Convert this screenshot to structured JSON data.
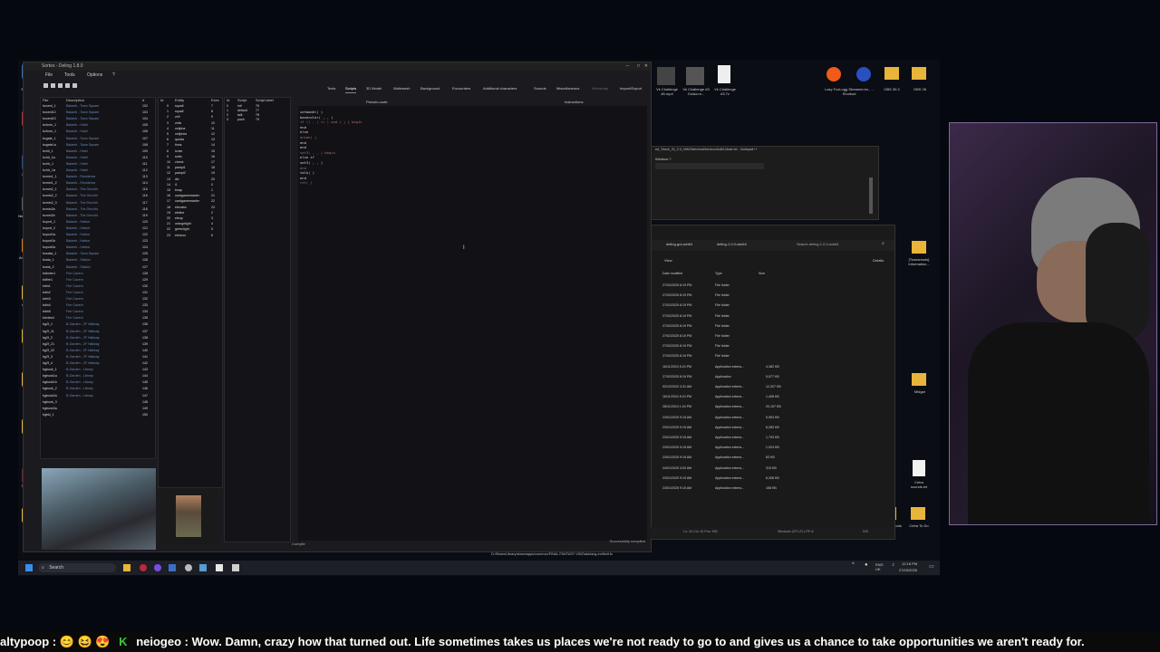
{
  "editor": {
    "title": "Sortes - Deling 1.8.0",
    "menu": [
      "File",
      "Tools",
      "Options",
      "?"
    ],
    "tabs": [
      "Texts",
      "Scripts",
      "3D Model",
      "Walkmesh",
      "Background",
      "Encounters",
      "Additional characters",
      "Sounds",
      "Miscellaneous",
      "Worldmap",
      "Import/Export"
    ],
    "field_headers": [
      "File",
      "Description",
      "#"
    ],
    "entity_headers": [
      "Id",
      "Entity",
      "Exec"
    ],
    "script_headers": [
      "Id",
      "Script",
      "Script label"
    ],
    "code_tabs": [
      "Pseudo-code",
      "Instructions"
    ],
    "fields": [
      {
        "file": "bccent_1",
        "desc": "Balamb - Town Square",
        "n": "102"
      },
      {
        "file": "bccent12",
        "desc": "Balamb - Town Square",
        "n": "103"
      },
      {
        "file": "bccent13",
        "desc": "Balamb - Town Square",
        "n": "104"
      },
      {
        "file": "bcform_1",
        "desc": "Balamb - Hotel",
        "n": "105"
      },
      {
        "file": "bcform_1",
        "desc": "Balamb - Hotel",
        "n": "106"
      },
      {
        "file": "bcgate_1",
        "desc": "Balamb - Town Square",
        "n": "107"
      },
      {
        "file": "bcgate1a",
        "desc": "Balamb - Town Square",
        "n": "108"
      },
      {
        "file": "bchtl_1",
        "desc": "Balamb - Hotel",
        "n": "109"
      },
      {
        "file": "bchtl_1a",
        "desc": "Balamb - Hotel",
        "n": "110"
      },
      {
        "file": "bchtr_1",
        "desc": "Balamb - Hotel",
        "n": "111"
      },
      {
        "file": "bchtr_1a",
        "desc": "Balamb - Hotel",
        "n": "112"
      },
      {
        "file": "bcmin1_1",
        "desc": "Balamb - Residence",
        "n": "113"
      },
      {
        "file": "bcmin1_2",
        "desc": "Balamb - Residence",
        "n": "114"
      },
      {
        "file": "bcmin2_1",
        "desc": "Balamb - The Dincht's",
        "n": "115"
      },
      {
        "file": "bcmin2_2",
        "desc": "Balamb - The Dincht's",
        "n": "116"
      },
      {
        "file": "bcmin2_3",
        "desc": "Balamb - The Dincht's",
        "n": "117"
      },
      {
        "file": "bcmin2a",
        "desc": "Balamb - The Dincht's",
        "n": "118"
      },
      {
        "file": "bcmin2b",
        "desc": "Balamb - The Dincht's",
        "n": "119"
      },
      {
        "file": "bcport_1",
        "desc": "Balamb - Harbor",
        "n": "120"
      },
      {
        "file": "bcport_2",
        "desc": "Balamb - Harbor",
        "n": "121"
      },
      {
        "file": "bcport1a",
        "desc": "Balamb - Harbor",
        "n": "122"
      },
      {
        "file": "bcport1b",
        "desc": "Balamb - Harbor",
        "n": "123"
      },
      {
        "file": "bcport2a",
        "desc": "Balamb - Harbor",
        "n": "124"
      },
      {
        "file": "bcsaka_1",
        "desc": "Balamb - Town Square",
        "n": "125"
      },
      {
        "file": "bcsta_1",
        "desc": "Balamb - Station",
        "n": "126"
      },
      {
        "file": "bcsta_2",
        "desc": "Balamb - Station",
        "n": "127"
      },
      {
        "file": "bdenter1",
        "desc": "Fire Cavern",
        "n": "128"
      },
      {
        "file": "bdfire1",
        "desc": "Fire Cavern",
        "n": "129"
      },
      {
        "file": "bdin1",
        "desc": "Fire Cavern",
        "n": "130"
      },
      {
        "file": "bdin2",
        "desc": "Fire Cavern",
        "n": "131"
      },
      {
        "file": "bdin3",
        "desc": "Fire Cavern",
        "n": "132"
      },
      {
        "file": "bdin4",
        "desc": "Fire Cavern",
        "n": "133"
      },
      {
        "file": "bdin5",
        "desc": "Fire Cavern",
        "n": "134"
      },
      {
        "file": "bdview1",
        "desc": "Fire Cavern",
        "n": "135"
      },
      {
        "file": "bg2f_1",
        "desc": "B-Garden - 2F Hallway",
        "n": "136"
      },
      {
        "file": "bg2f_11",
        "desc": "B-Garden - 2F Hallway",
        "n": "137"
      },
      {
        "file": "bg2f_2",
        "desc": "B-Garden - 2F Hallway",
        "n": "138"
      },
      {
        "file": "bg2f_21",
        "desc": "B-Garden - 2F Hallway",
        "n": "139"
      },
      {
        "file": "bg2f_22",
        "desc": "B-Garden - 2F Hallway",
        "n": "140"
      },
      {
        "file": "bg2f_3",
        "desc": "B-Garden - 2F Hallway",
        "n": "141"
      },
      {
        "file": "bg2f_4",
        "desc": "B-Garden - 2F Hallway",
        "n": "142"
      },
      {
        "file": "bgbook_1",
        "desc": "B-Garden - Library",
        "n": "143"
      },
      {
        "file": "bgbook1a",
        "desc": "B-Garden - Library",
        "n": "144"
      },
      {
        "file": "bgbook1b",
        "desc": "B-Garden - Library",
        "n": "145"
      },
      {
        "file": "bgbook_2",
        "desc": "B-Garden - Library",
        "n": "146"
      },
      {
        "file": "bgbook2a",
        "desc": "B-Garden - Library",
        "n": "147"
      },
      {
        "file": "bgbook_3",
        "desc": "",
        "n": "148"
      },
      {
        "file": "bgbook3a",
        "desc": "",
        "n": "149"
      },
      {
        "file": "bgbkl_1",
        "desc": "",
        "n": "150"
      }
    ],
    "entities": [
      {
        "id": "0",
        "name": "squall",
        "n": "7"
      },
      {
        "id": "1",
        "name": "squall",
        "n": "8"
      },
      {
        "id": "2",
        "name": "zell",
        "n": "9"
      },
      {
        "id": "3",
        "name": "zells",
        "n": "10"
      },
      {
        "id": "4",
        "name": "cellpha",
        "n": "11"
      },
      {
        "id": "5",
        "name": "cellphes",
        "n": "12"
      },
      {
        "id": "6",
        "name": "quicks",
        "n": "13"
      },
      {
        "id": "7",
        "name": "tinos",
        "n": "14"
      },
      {
        "id": "8",
        "name": "ivoke",
        "n": "15"
      },
      {
        "id": "9",
        "name": "sotto",
        "n": "16"
      },
      {
        "id": "10",
        "name": "check",
        "n": "17"
      },
      {
        "id": "11",
        "name": "pampi1",
        "n": "18"
      },
      {
        "id": "12",
        "name": "pampi2",
        "n": "19"
      },
      {
        "id": "13",
        "name": "dic",
        "n": "20"
      },
      {
        "id": "14",
        "name": "l1",
        "n": "0"
      },
      {
        "id": "15",
        "name": "bnap",
        "n": "1"
      },
      {
        "id": "16",
        "name": "cardgamemaster",
        "n": "21"
      },
      {
        "id": "17",
        "name": "cardgamemaster",
        "n": "22"
      },
      {
        "id": "18",
        "name": "elevator",
        "n": "23"
      },
      {
        "id": "19",
        "name": "eleline",
        "n": "2"
      },
      {
        "id": "20",
        "name": "eleup",
        "n": "3"
      },
      {
        "id": "21",
        "name": "orangelight",
        "n": "4"
      },
      {
        "id": "22",
        "name": "greenlight",
        "n": "5"
      },
      {
        "id": "23",
        "name": "eledoor",
        "n": "6"
      }
    ],
    "scripts": [
      {
        "id": "0",
        "name": "init",
        "label": "76"
      },
      {
        "id": "1",
        "name": "default",
        "label": "77"
      },
      {
        "id": "2",
        "name": "talk",
        "label": "78"
      },
      {
        "id": "3",
        "name": "push",
        "label": "79"
      }
    ],
    "code_lines": [
      "setmodel( )",
      "basecolor( , , )",
      "if (( , ) == ) and ( ) { begin",
      "  end",
      "  else",
      "  anime( )",
      "  end",
      "  end",
      "  set3( , , ) begin",
      "else if",
      "  set3( , , )",
      "end",
      "  talk( )",
      "end",
      "ret( )"
    ],
    "compile_label": "Compile",
    "status_text": "Successfully compiled",
    "path_text": "D:/SteamLibrary/steamapps/common/FINAL FANTASY VIII/Data/lang-en/field.fs"
  },
  "notepad": {
    "title": "ed_Stock_SI_2.0_NWS\\bevinod\\bevinod\\rdl0-Mast.txt - Notepad++",
    "menu": "Window  ?"
  },
  "explorer": {
    "breadcrumb": [
      "deling-gui-win64",
      "deling-1.0.0-win64"
    ],
    "search_placeholder": "Search deling-1.0.0-win64",
    "view_label": "View",
    "details_label": "Details",
    "headers": [
      "Date modified",
      "Type",
      "Size"
    ],
    "rows": [
      {
        "date": "27/02/2025 8:19 PM",
        "type": "File folder",
        "size": ""
      },
      {
        "date": "27/02/2025 8:19 PM",
        "type": "File folder",
        "size": ""
      },
      {
        "date": "27/02/2025 8:19 PM",
        "type": "File folder",
        "size": ""
      },
      {
        "date": "27/02/2025 8:19 PM",
        "type": "File folder",
        "size": ""
      },
      {
        "date": "27/02/2025 8:19 PM",
        "type": "File folder",
        "size": ""
      },
      {
        "date": "27/02/2025 8:19 PM",
        "type": "File folder",
        "size": ""
      },
      {
        "date": "27/02/2025 8:19 PM",
        "type": "File folder",
        "size": ""
      },
      {
        "date": "27/02/2025 8:19 PM",
        "type": "File folder",
        "size": ""
      },
      {
        "date": "16/11/2024 5:24 PM",
        "type": "Application extens...",
        "size": "4,382 KB"
      },
      {
        "date": "27/02/2025 8:19 PM",
        "type": "Application",
        "size": "5,577 KB"
      },
      {
        "date": "02/12/2020 3:31 AM",
        "type": "Application extens...",
        "size": "12,307 KB"
      },
      {
        "date": "16/11/2024 5:24 PM",
        "type": "Application extens...",
        "size": "1,408 KB"
      },
      {
        "date": "28/11/2024 1:04 PM",
        "type": "Application extens...",
        "size": "20,157 KB"
      },
      {
        "date": "23/01/2025 9:15 AM",
        "type": "Application extens...",
        "size": "5,953 KB"
      },
      {
        "date": "23/01/2025 9:15 AM",
        "type": "Application extens...",
        "size": "6,283 KB"
      },
      {
        "date": "23/01/2025 9:15 AM",
        "type": "Application extens...",
        "size": "1,793 KB"
      },
      {
        "date": "23/01/2025 9:15 AM",
        "type": "Application extens...",
        "size": "1,924 KB"
      },
      {
        "date": "23/01/2025 9:15 AM",
        "type": "Application extens...",
        "size": "63 KB"
      },
      {
        "date": "24/01/2025 3:00 AM",
        "type": "Application extens...",
        "size": "315 KB"
      },
      {
        "date": "23/01/2025 9:15 AM",
        "type": "Application extens...",
        "size": "6,308 KB"
      },
      {
        "date": "23/01/2025 9:15 AM",
        "type": "Application extens...",
        "size": "158 KB"
      }
    ],
    "statusbar": "Ln: 34  Col: 44  Pos: 505",
    "statusbar_right": "Windows (CR LF)   UTF-8",
    "ins": "INS"
  },
  "desktop": {
    "top_icons": [
      {
        "label": "Vk Challenge #5.mp4"
      },
      {
        "label": "Vk Challenge #3 Guida.m..."
      },
      {
        "label": "Vk Challenge #3.7z"
      }
    ],
    "top_right_icons": [
      {
        "label": "Lazy FoxLogg Streamer.bo... - Shortcut"
      },
      {
        "label": "OBS 30.2"
      },
      {
        "label": "OBS 28"
      }
    ],
    "right_icons": [
      {
        "label": "[Tsunamods] Information..."
      },
      {
        "label": "Midgar"
      },
      {
        "label": "Cetra sounds.txt"
      },
      {
        "label": "Modding Tools"
      },
      {
        "label": "Cetra To Do"
      }
    ],
    "left_icons": [
      "Recycle Bin",
      "BEACH",
      "7th Heaven",
      "NexR Replicant",
      "Amazon Battle (b...",
      "umodel_64",
      "FMode",
      "unrealplor",
      "KDF FMP",
      "Thumbnails",
      "Tsunami"
    ]
  },
  "taskbar": {
    "search_placeholder": "Search",
    "tray_lang": "ENG UK",
    "time": "12:18 PM",
    "date": "27/03/2025"
  },
  "ticker": {
    "user1": "altypoop",
    "emotes": "😊 😆 😍",
    "user2": "neiogeo",
    "message": "Wow. Damn, crazy how that turned out. Life sometimes takes us places we're not ready to go to and gives us a chance to take opportunities we aren't ready for."
  }
}
